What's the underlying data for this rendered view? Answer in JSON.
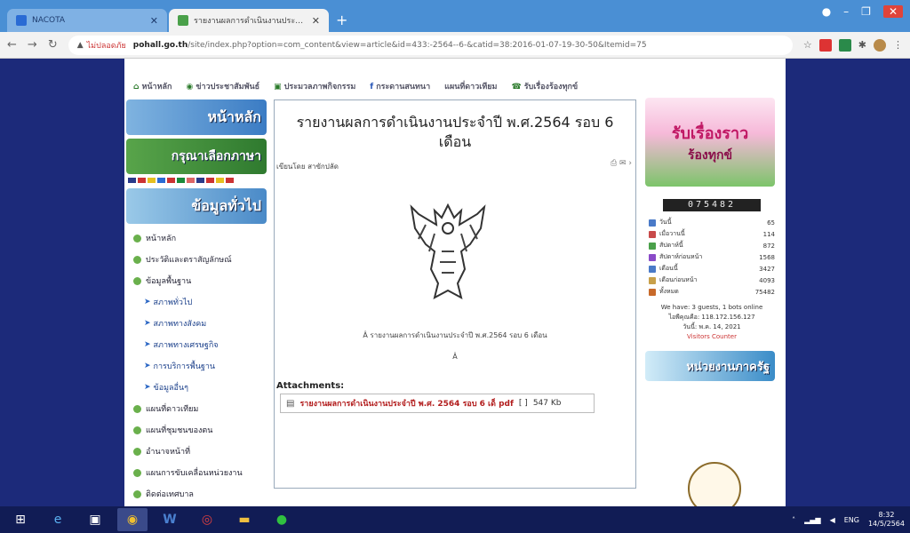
{
  "browser": {
    "tabs": [
      {
        "title": "NACOTA",
        "fav_color": "#2a6bd4"
      },
      {
        "title": "รายงานผลการดำเนินงานประจำปี พ.ศ...",
        "fav_color": "#4aa04a"
      }
    ],
    "new_tab": "+",
    "url_warning": "▲",
    "url_security": "ไม่ปลอดภัย",
    "url_host": "pohall.go.th",
    "url_path": "/site/index.php?option=com_content&view=article&id=433:-2564--6-&catid=38:2016-01-07-19-30-50&Itemid=75"
  },
  "topnav": {
    "items": [
      "หน้าหลัก",
      "ข่าวประชาสัมพันธ์",
      "ประมวลภาพกิจกรรม",
      "กระดานสนทนา",
      "แผนที่ดาวเทียม",
      "รับเรื่องร้องทุกข์"
    ]
  },
  "sidebar": {
    "banner_home": "หน้าหลัก",
    "banner_lang": "กรุณาเลือกภาษา",
    "banner_info": "ข้อมูลทั่วไป",
    "menu": [
      {
        "label": "หน้าหลัก",
        "sub": false
      },
      {
        "label": "ประวัติและตราสัญลักษณ์",
        "sub": false
      },
      {
        "label": "ข้อมูลพื้นฐาน",
        "sub": false
      },
      {
        "label": "สภาพทั่วไป",
        "sub": true
      },
      {
        "label": "สภาพทางสังคม",
        "sub": true
      },
      {
        "label": "สภาพทางเศรษฐกิจ",
        "sub": true
      },
      {
        "label": "การบริการพื้นฐาน",
        "sub": true
      },
      {
        "label": "ข้อมูลอื่นๆ",
        "sub": true
      },
      {
        "label": "แผนที่ดาวเทียม",
        "sub": false
      },
      {
        "label": "แผนที่ชุมชนของตน",
        "sub": false
      },
      {
        "label": "อำนาจหน้าที่",
        "sub": false
      },
      {
        "label": "แผนการขับเคลื่อนหน่วยงาน",
        "sub": false
      },
      {
        "label": "ติดต่อเทศบาล",
        "sub": false
      }
    ]
  },
  "article": {
    "title": "รายงานผลการดำเนินงานประจำปี พ.ศ.2564 รอบ 6 เดือน",
    "byline": "เขียนโดย สาขักปลัด",
    "icons": "⎙ ✉ ›",
    "caption": "Â รายงานผลการดำเนินงานประจำปี พ.ศ.2564 รอบ 6 เดือน",
    "caption2": "Â",
    "attachments_label": "Attachments:",
    "attachment_name": "รายงานผลการดำเนินงานประจำปี พ.ศ. 2564 รอบ 6 เด็ pdf",
    "attachment_count": "[ ]",
    "attachment_size": "547 Kb"
  },
  "right": {
    "promo_l1": "รับเรื่องราว",
    "promo_l2": "ร้องทุกข์",
    "counter": "075482",
    "stats": [
      {
        "label": "วันนี้",
        "value": "65",
        "color": "#4a7ac8"
      },
      {
        "label": "เมื่อวานนี้",
        "value": "114",
        "color": "#c84a4a"
      },
      {
        "label": "สัปดาห์นี้",
        "value": "872",
        "color": "#4aa04a"
      },
      {
        "label": "สัปดาห์ก่อนหน้า",
        "value": "1568",
        "color": "#8a4ac8"
      },
      {
        "label": "เดือนนี้",
        "value": "3427",
        "color": "#4a7ac8"
      },
      {
        "label": "เดือนก่อนหน้า",
        "value": "4093",
        "color": "#c8a04a"
      },
      {
        "label": "ทั้งหมด",
        "value": "75482",
        "color": "#c86a2a"
      }
    ],
    "visitors_line": "We have: 3 guests, 1 bots online",
    "ip_line": "ไอพีคุณคือ: 118.172.156.127",
    "date_line": "วันนี้: พ.ค. 14, 2021",
    "counter_link": "Visitors Counter",
    "promo2": "หน่วยงานภาครัฐ"
  },
  "taskbar": {
    "lang": "ENG",
    "time": "8:32",
    "date": "14/5/2564"
  }
}
